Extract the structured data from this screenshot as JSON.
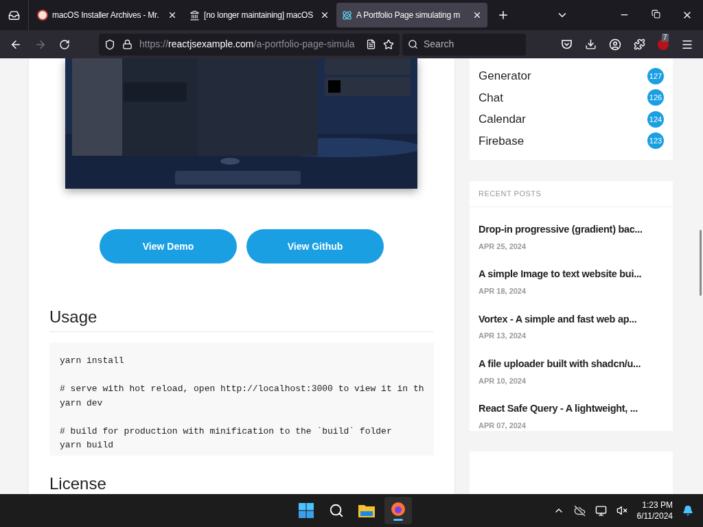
{
  "browser": {
    "tabs": [
      {
        "title": "macOS Installer Archives - Mr.",
        "kind": "avatar",
        "selected": false
      },
      {
        "title": "[no longer maintaining] macOS",
        "kind": "landmark",
        "selected": false
      },
      {
        "title": "A Portfolio Page simulating m",
        "kind": "react",
        "selected": true
      }
    ],
    "url": {
      "scheme": "https://",
      "host": "reactjsexample.com",
      "path": "/a-portfolio-page-simula"
    },
    "search": {
      "placeholder": "Search"
    },
    "extension_badge": "7"
  },
  "article": {
    "preview": {
      "kind": "picture"
    },
    "buttons": [
      "View Demo",
      "View Github"
    ],
    "usage": {
      "heading": "Usage",
      "code": [
        [
          "yarn install"
        ],
        [
          "# serve with hot reload, open http://localhost:3000 to view it in th",
          "yarn dev"
        ],
        [
          "# build for production with minification to the `build` folder",
          "yarn build"
        ]
      ]
    },
    "license_heading": "License"
  },
  "sidebar": {
    "categories": [
      {
        "name": "Generator",
        "count": "127"
      },
      {
        "name": "Chat",
        "count": "126"
      },
      {
        "name": "Calendar",
        "count": "124"
      },
      {
        "name": "Firebase",
        "count": "123"
      }
    ],
    "recent_posts": {
      "heading": "RECENT POSTS",
      "posts": [
        {
          "title": "Drop-in progressive (gradient) bac...",
          "date": "APR 25, 2024"
        },
        {
          "title": "A simple Image to text website bui...",
          "date": "APR 18, 2024"
        },
        {
          "title": "Vortex - A simple and fast web ap...",
          "date": "APR 13, 2024"
        },
        {
          "title": "A file uploader built with shadcn/u...",
          "date": "APR 10, 2024"
        },
        {
          "title": "React Safe Query - A lightweight, ...",
          "date": "APR 07, 2024"
        }
      ]
    }
  },
  "taskbar": {
    "time": "1:23 PM",
    "date": "6/11/2024"
  }
}
